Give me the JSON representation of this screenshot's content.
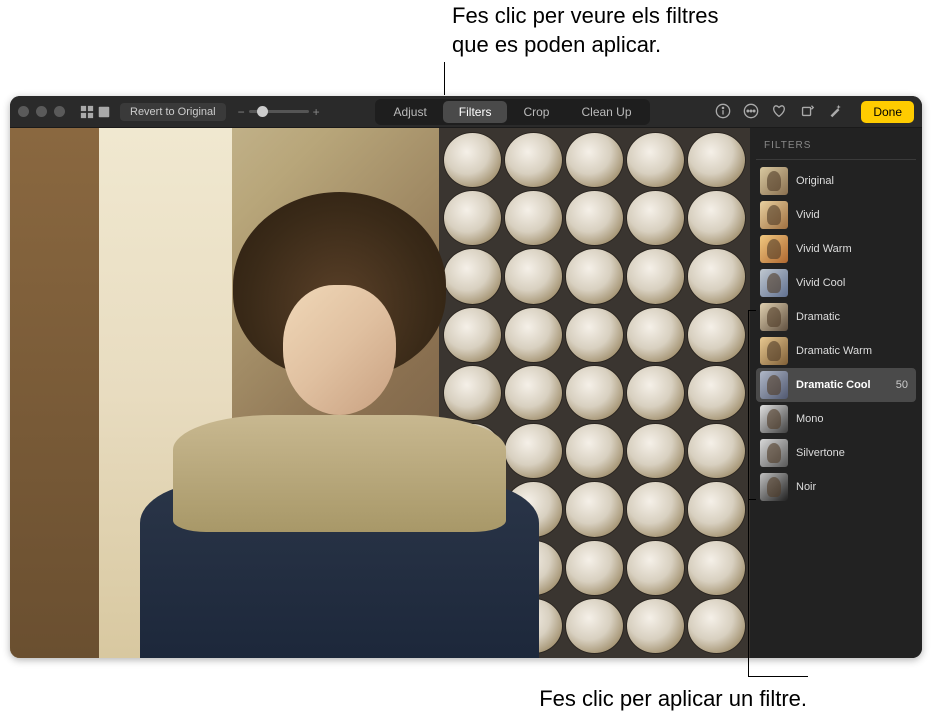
{
  "callouts": {
    "top": "Fes clic per veure els filtres que es poden aplicar.",
    "bottom": "Fes clic per aplicar un filtre."
  },
  "toolbar": {
    "revert_label": "Revert to Original",
    "tabs": {
      "adjust": "Adjust",
      "filters": "Filters",
      "crop": "Crop",
      "cleanup": "Clean Up"
    },
    "done_label": "Done"
  },
  "panel": {
    "title": "FILTERS",
    "filters": [
      {
        "label": "Original",
        "thumb": "ft-original"
      },
      {
        "label": "Vivid",
        "thumb": "ft-vivid"
      },
      {
        "label": "Vivid Warm",
        "thumb": "ft-vivid-warm"
      },
      {
        "label": "Vivid Cool",
        "thumb": "ft-vivid-cool"
      },
      {
        "label": "Dramatic",
        "thumb": "ft-dramatic"
      },
      {
        "label": "Dramatic Warm",
        "thumb": "ft-dramatic-warm"
      },
      {
        "label": "Dramatic Cool",
        "thumb": "ft-dramatic-cool",
        "selected": true,
        "value": "50"
      },
      {
        "label": "Mono",
        "thumb": "ft-mono"
      },
      {
        "label": "Silvertone",
        "thumb": "ft-silvertone"
      },
      {
        "label": "Noir",
        "thumb": "ft-noir"
      }
    ]
  }
}
